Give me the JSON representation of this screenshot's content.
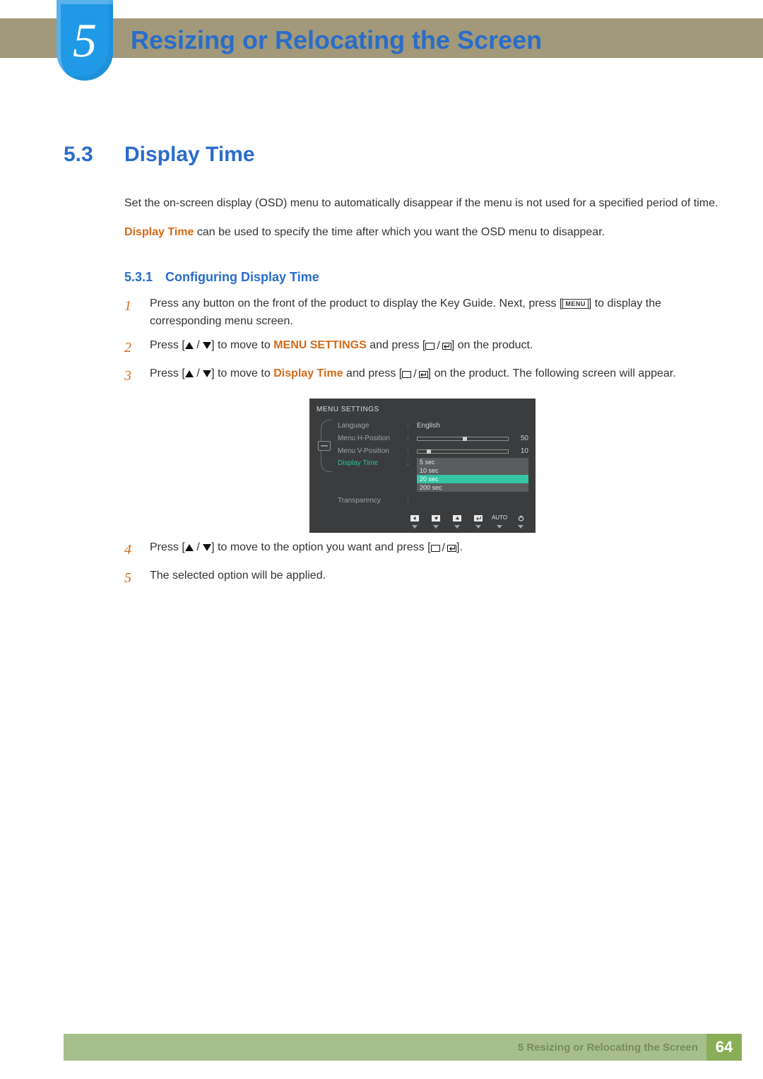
{
  "header": {
    "chapter_number": "5",
    "chapter_title": "Resizing or Relocating the Screen"
  },
  "section": {
    "number": "5.3",
    "title": "Display Time",
    "intro1": "Set the on-screen display (OSD) menu to automatically disappear if the menu is not used for a specified period of time.",
    "intro2_pre": "Display Time",
    "intro2_post": " can be used to specify the time after which you want the OSD menu to disappear."
  },
  "subsection": {
    "number": "5.3.1",
    "title": "Configuring Display Time"
  },
  "steps": {
    "s1": {
      "num": "1",
      "pre": "Press any button on the front of the product to display the Key Guide. Next, press [",
      "menu_label": "MENU",
      "post": "] to display the corresponding menu screen."
    },
    "s2": {
      "num": "2",
      "pre": "Press [",
      "mid": "] to move to ",
      "target": "MENU SETTINGS",
      "post": " and press [",
      "end": "] on the product."
    },
    "s3": {
      "num": "3",
      "pre": "Press [",
      "mid": "] to move to ",
      "target": "Display Time",
      "post": " and press [",
      "end": "] on the product. The following screen will appear."
    },
    "s4": {
      "num": "4",
      "pre": "Press [",
      "mid": "] to move to the option you want and press [",
      "end": "]."
    },
    "s5": {
      "num": "5",
      "text": "The selected option will be applied."
    }
  },
  "osd": {
    "title": "MENU SETTINGS",
    "rows": {
      "language": {
        "label": "Language",
        "value": "English"
      },
      "hpos": {
        "label": "Menu H-Position",
        "value": "50",
        "pct": 50
      },
      "vpos": {
        "label": "Menu V-Position",
        "value": "10",
        "pct": 10
      },
      "dtime": {
        "label": "Display Time"
      },
      "transp": {
        "label": "Transparency"
      }
    },
    "dropdown": [
      "5 sec",
      "10 sec",
      "20 sec",
      "200 sec"
    ],
    "dropdown_highlight": "20 sec",
    "nav_auto": "AUTO"
  },
  "footer": {
    "text": "5 Resizing or Relocating the Screen",
    "page": "64"
  }
}
